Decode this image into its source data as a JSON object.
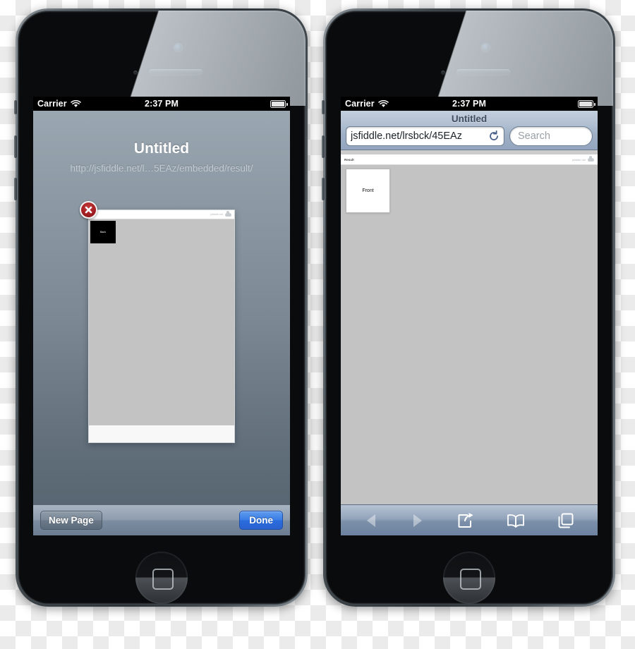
{
  "scene": {
    "description": "Two iPhone 5 devices side by side on a transparency checkerboard background",
    "background": "transparency-checkerboard"
  },
  "left_phone": {
    "name": "iphone-page-manager",
    "status_bar": {
      "carrier": "Carrier",
      "wifi_icon": "wifi-icon",
      "time": "2:37 PM",
      "battery_icon": "battery-icon"
    },
    "page_manager": {
      "title": "Untitled",
      "url": "http://jsfiddle.net/l…5EAz/embedded/result/",
      "close_badge_icon": "close-x-icon",
      "thumbnail": {
        "mini_chrome_text": "jsfiddle.net",
        "mini_cloud_icon": "cloud-icon",
        "card_label": "Back"
      },
      "toolbar": {
        "new_page_label": "New Page",
        "done_label": "Done"
      }
    }
  },
  "right_phone": {
    "name": "iphone-safari",
    "status_bar": {
      "carrier": "Carrier",
      "wifi_icon": "wifi-icon",
      "time": "2:37 PM",
      "battery_icon": "battery-icon"
    },
    "safari": {
      "title": "Untitled",
      "url_value": "jsfiddle.net/lrsbck/45EAz",
      "reload_icon": "reload-icon",
      "search_placeholder": "Search",
      "content": {
        "result_label": "Result",
        "corner_text": "jsfiddle.net",
        "cloud_icon": "cloud-icon",
        "card_label": "Front"
      },
      "toolbar": {
        "back_icon": "back-arrow-icon",
        "forward_icon": "forward-arrow-icon",
        "share_icon": "share-icon",
        "bookmarks_icon": "bookmarks-book-icon",
        "tabs_icon": "tabs-pages-icon"
      }
    }
  },
  "colors": {
    "accent_blue": "#3b7de6",
    "close_red": "#a51f23",
    "toolbar_blue": "#93a4bb",
    "page_bg_gray": "#c3c3c3"
  }
}
